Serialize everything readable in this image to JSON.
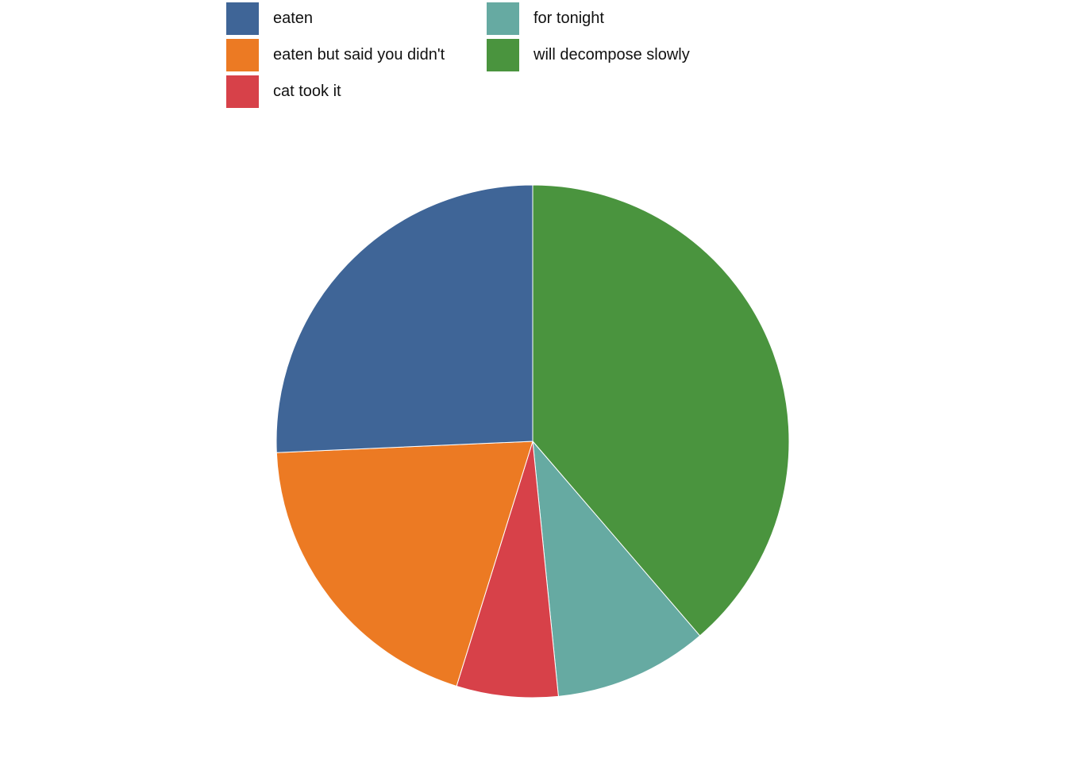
{
  "chart_data": {
    "type": "pie",
    "title": "",
    "legend_position": "top",
    "start": "top, clockwise, reverse of legend order",
    "slices": [
      {
        "name": "eaten",
        "value": 25.7,
        "color": "#3f6597"
      },
      {
        "name": "eaten but said you didn't",
        "value": 19.5,
        "color": "#ec7a23"
      },
      {
        "name": "cat took it",
        "value": 6.4,
        "color": "#d74149"
      },
      {
        "name": "for tonight",
        "value": 9.7,
        "color": "#66aaa2"
      },
      {
        "name": "will decompose slowly",
        "value": 38.7,
        "color": "#4a943e"
      }
    ]
  }
}
